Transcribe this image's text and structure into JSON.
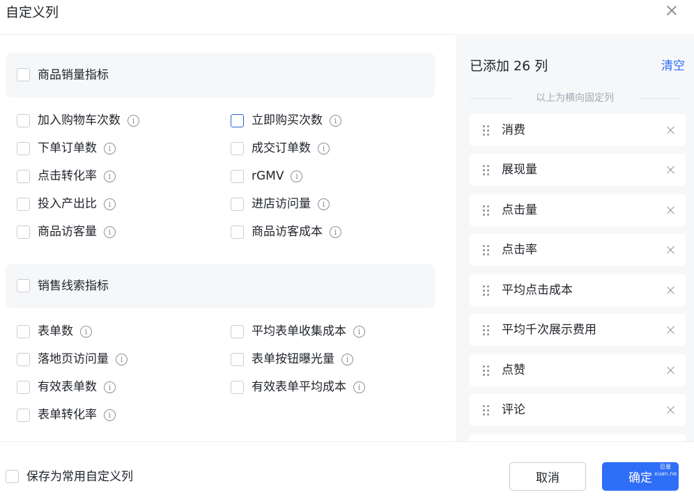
{
  "dialog": {
    "title": "自定义列"
  },
  "groups": [
    {
      "label": "商品销量指标",
      "items": [
        {
          "label": "加入购物车次数"
        },
        {
          "label": "立即购买次数"
        },
        {
          "label": "下单订单数"
        },
        {
          "label": "成交订单数"
        },
        {
          "label": "点击转化率"
        },
        {
          "label": "rGMV"
        },
        {
          "label": "投入产出比"
        },
        {
          "label": "进店访问量"
        },
        {
          "label": "商品访客量"
        },
        {
          "label": "商品访客成本"
        }
      ]
    },
    {
      "label": "销售线索指标",
      "items": [
        {
          "label": "表单数"
        },
        {
          "label": "平均表单收集成本"
        },
        {
          "label": "落地页访问量"
        },
        {
          "label": "表单按钮曝光量"
        },
        {
          "label": "有效表单数"
        },
        {
          "label": "有效表单平均成本"
        },
        {
          "label": "表单转化率"
        }
      ]
    }
  ],
  "info_glyph": "i",
  "selected": {
    "title": "已添加 26 列",
    "clear_label": "清空",
    "fixed_divider": "以上为横向固定列",
    "columns": [
      {
        "label": "消费"
      },
      {
        "label": "展现量"
      },
      {
        "label": "点击量"
      },
      {
        "label": "点击率"
      },
      {
        "label": "平均点击成本"
      },
      {
        "label": "平均千次展示费用"
      },
      {
        "label": "点赞"
      },
      {
        "label": "评论"
      }
    ]
  },
  "footer": {
    "save_label": "保存为常用自定义列",
    "cancel_label": "取消",
    "confirm_label": "确定",
    "watermark_line1": "巨量",
    "watermark_line2": "xuan.ne"
  },
  "colors": {
    "accent": "#2f6ef6",
    "link": "#2b6df5",
    "panel_bg": "#f6f7f9",
    "focus_border": "#2b5fd9"
  }
}
